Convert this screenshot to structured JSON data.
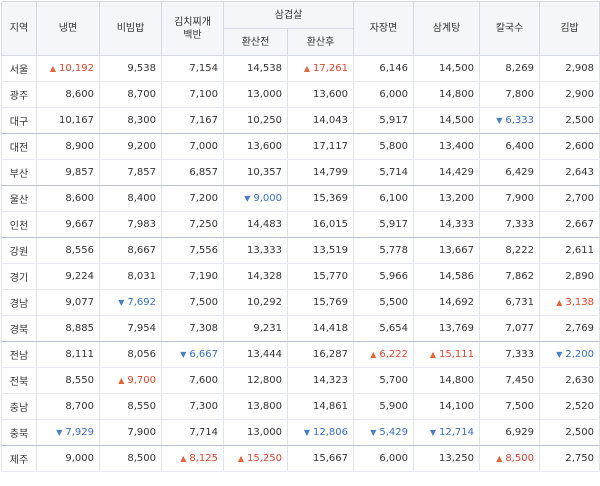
{
  "headers": {
    "region": "지역",
    "naengmyeon": "냉면",
    "bibimbap": "비빔밥",
    "kimchi_line1": "김치찌개",
    "kimchi_line2": "백반",
    "samgyeopsal": "삼겹살",
    "sam_before": "환산전",
    "sam_after": "환산후",
    "jajangmyeon": "자장면",
    "samgyetang": "삼계탕",
    "kalguksu": "칼국수",
    "gimbap": "김밥"
  },
  "icons": {
    "up": "triangle-up-icon",
    "down": "triangle-down-icon"
  },
  "colors": {
    "up": "#d9452f",
    "down": "#3a6fc0",
    "header_bg": "#f4f6fa"
  },
  "rows": [
    {
      "region": "서울",
      "cells": [
        {
          "v": "10,192",
          "t": "up"
        },
        {
          "v": "9,538",
          "t": ""
        },
        {
          "v": "7,154",
          "t": ""
        },
        {
          "v": "14,538",
          "t": ""
        },
        {
          "v": "17,261",
          "t": "up"
        },
        {
          "v": "6,146",
          "t": ""
        },
        {
          "v": "14,500",
          "t": ""
        },
        {
          "v": "8,269",
          "t": ""
        },
        {
          "v": "2,908",
          "t": ""
        }
      ]
    },
    {
      "region": "광주",
      "cells": [
        {
          "v": "8,600",
          "t": ""
        },
        {
          "v": "8,700",
          "t": ""
        },
        {
          "v": "7,100",
          "t": ""
        },
        {
          "v": "13,000",
          "t": ""
        },
        {
          "v": "13,600",
          "t": ""
        },
        {
          "v": "6,000",
          "t": ""
        },
        {
          "v": "14,800",
          "t": ""
        },
        {
          "v": "7,800",
          "t": ""
        },
        {
          "v": "2,900",
          "t": ""
        }
      ]
    },
    {
      "region": "대구",
      "cells": [
        {
          "v": "10,167",
          "t": ""
        },
        {
          "v": "8,300",
          "t": ""
        },
        {
          "v": "7,167",
          "t": ""
        },
        {
          "v": "10,250",
          "t": ""
        },
        {
          "v": "14,043",
          "t": ""
        },
        {
          "v": "5,917",
          "t": ""
        },
        {
          "v": "14,500",
          "t": ""
        },
        {
          "v": "6,333",
          "t": "down"
        },
        {
          "v": "2,500",
          "t": ""
        }
      ]
    },
    {
      "region": "대전",
      "cells": [
        {
          "v": "8,900",
          "t": ""
        },
        {
          "v": "9,200",
          "t": ""
        },
        {
          "v": "7,000",
          "t": ""
        },
        {
          "v": "13,600",
          "t": ""
        },
        {
          "v": "17,117",
          "t": ""
        },
        {
          "v": "5,800",
          "t": ""
        },
        {
          "v": "13,400",
          "t": ""
        },
        {
          "v": "6,400",
          "t": ""
        },
        {
          "v": "2,600",
          "t": ""
        }
      ]
    },
    {
      "region": "부산",
      "cells": [
        {
          "v": "9,857",
          "t": ""
        },
        {
          "v": "7,857",
          "t": ""
        },
        {
          "v": "6,857",
          "t": ""
        },
        {
          "v": "10,357",
          "t": ""
        },
        {
          "v": "14,799",
          "t": ""
        },
        {
          "v": "5,714",
          "t": ""
        },
        {
          "v": "14,429",
          "t": ""
        },
        {
          "v": "6,429",
          "t": ""
        },
        {
          "v": "2,643",
          "t": ""
        }
      ]
    },
    {
      "region": "울산",
      "cells": [
        {
          "v": "8,600",
          "t": ""
        },
        {
          "v": "8,400",
          "t": ""
        },
        {
          "v": "7,200",
          "t": ""
        },
        {
          "v": "9,000",
          "t": "down"
        },
        {
          "v": "15,369",
          "t": ""
        },
        {
          "v": "6,100",
          "t": ""
        },
        {
          "v": "13,200",
          "t": ""
        },
        {
          "v": "7,900",
          "t": ""
        },
        {
          "v": "2,700",
          "t": ""
        }
      ]
    },
    {
      "region": "인천",
      "cells": [
        {
          "v": "9,667",
          "t": ""
        },
        {
          "v": "7,983",
          "t": ""
        },
        {
          "v": "7,250",
          "t": ""
        },
        {
          "v": "14,483",
          "t": ""
        },
        {
          "v": "16,015",
          "t": ""
        },
        {
          "v": "5,917",
          "t": ""
        },
        {
          "v": "14,333",
          "t": ""
        },
        {
          "v": "7,333",
          "t": ""
        },
        {
          "v": "2,667",
          "t": ""
        }
      ]
    },
    {
      "region": "강원",
      "cells": [
        {
          "v": "8,556",
          "t": ""
        },
        {
          "v": "8,667",
          "t": ""
        },
        {
          "v": "7,556",
          "t": ""
        },
        {
          "v": "13,333",
          "t": ""
        },
        {
          "v": "13,519",
          "t": ""
        },
        {
          "v": "5,778",
          "t": ""
        },
        {
          "v": "13,667",
          "t": ""
        },
        {
          "v": "8,222",
          "t": ""
        },
        {
          "v": "2,611",
          "t": ""
        }
      ]
    },
    {
      "region": "경기",
      "cells": [
        {
          "v": "9,224",
          "t": ""
        },
        {
          "v": "8,031",
          "t": ""
        },
        {
          "v": "7,190",
          "t": ""
        },
        {
          "v": "14,328",
          "t": ""
        },
        {
          "v": "15,770",
          "t": ""
        },
        {
          "v": "5,966",
          "t": ""
        },
        {
          "v": "14,586",
          "t": ""
        },
        {
          "v": "7,862",
          "t": ""
        },
        {
          "v": "2,890",
          "t": ""
        }
      ]
    },
    {
      "region": "경남",
      "cells": [
        {
          "v": "9,077",
          "t": ""
        },
        {
          "v": "7,692",
          "t": "down"
        },
        {
          "v": "7,500",
          "t": ""
        },
        {
          "v": "10,292",
          "t": ""
        },
        {
          "v": "15,769",
          "t": ""
        },
        {
          "v": "5,500",
          "t": ""
        },
        {
          "v": "14,692",
          "t": ""
        },
        {
          "v": "6,731",
          "t": ""
        },
        {
          "v": "3,138",
          "t": "up"
        }
      ]
    },
    {
      "region": "경북",
      "cells": [
        {
          "v": "8,885",
          "t": ""
        },
        {
          "v": "7,954",
          "t": ""
        },
        {
          "v": "7,308",
          "t": ""
        },
        {
          "v": "9,231",
          "t": ""
        },
        {
          "v": "14,418",
          "t": ""
        },
        {
          "v": "5,654",
          "t": ""
        },
        {
          "v": "13,769",
          "t": ""
        },
        {
          "v": "7,077",
          "t": ""
        },
        {
          "v": "2,769",
          "t": ""
        }
      ]
    },
    {
      "region": "전남",
      "cells": [
        {
          "v": "8,111",
          "t": ""
        },
        {
          "v": "8,056",
          "t": ""
        },
        {
          "v": "6,667",
          "t": "down"
        },
        {
          "v": "13,444",
          "t": ""
        },
        {
          "v": "16,287",
          "t": ""
        },
        {
          "v": "6,222",
          "t": "up"
        },
        {
          "v": "15,111",
          "t": "up"
        },
        {
          "v": "7,333",
          "t": ""
        },
        {
          "v": "2,200",
          "t": "down"
        }
      ]
    },
    {
      "region": "전북",
      "cells": [
        {
          "v": "8,550",
          "t": ""
        },
        {
          "v": "9,700",
          "t": "up"
        },
        {
          "v": "7,600",
          "t": ""
        },
        {
          "v": "12,800",
          "t": ""
        },
        {
          "v": "14,323",
          "t": ""
        },
        {
          "v": "5,700",
          "t": ""
        },
        {
          "v": "14,800",
          "t": ""
        },
        {
          "v": "7,450",
          "t": ""
        },
        {
          "v": "2,630",
          "t": ""
        }
      ]
    },
    {
      "region": "충남",
      "cells": [
        {
          "v": "8,700",
          "t": ""
        },
        {
          "v": "8,550",
          "t": ""
        },
        {
          "v": "7,300",
          "t": ""
        },
        {
          "v": "13,800",
          "t": ""
        },
        {
          "v": "14,861",
          "t": ""
        },
        {
          "v": "5,900",
          "t": ""
        },
        {
          "v": "14,100",
          "t": ""
        },
        {
          "v": "7,500",
          "t": ""
        },
        {
          "v": "2,520",
          "t": ""
        }
      ]
    },
    {
      "region": "충북",
      "cells": [
        {
          "v": "7,929",
          "t": "down"
        },
        {
          "v": "7,900",
          "t": ""
        },
        {
          "v": "7,714",
          "t": ""
        },
        {
          "v": "13,000",
          "t": ""
        },
        {
          "v": "12,806",
          "t": "down"
        },
        {
          "v": "5,429",
          "t": "down"
        },
        {
          "v": "12,714",
          "t": "down"
        },
        {
          "v": "6,929",
          "t": ""
        },
        {
          "v": "2,500",
          "t": ""
        }
      ]
    },
    {
      "region": "제주",
      "cells": [
        {
          "v": "9,000",
          "t": ""
        },
        {
          "v": "8,500",
          "t": ""
        },
        {
          "v": "8,125",
          "t": "up"
        },
        {
          "v": "15,250",
          "t": "up"
        },
        {
          "v": "15,667",
          "t": ""
        },
        {
          "v": "6,000",
          "t": ""
        },
        {
          "v": "13,250",
          "t": ""
        },
        {
          "v": "8,500",
          "t": "up"
        },
        {
          "v": "2,750",
          "t": ""
        }
      ]
    }
  ]
}
